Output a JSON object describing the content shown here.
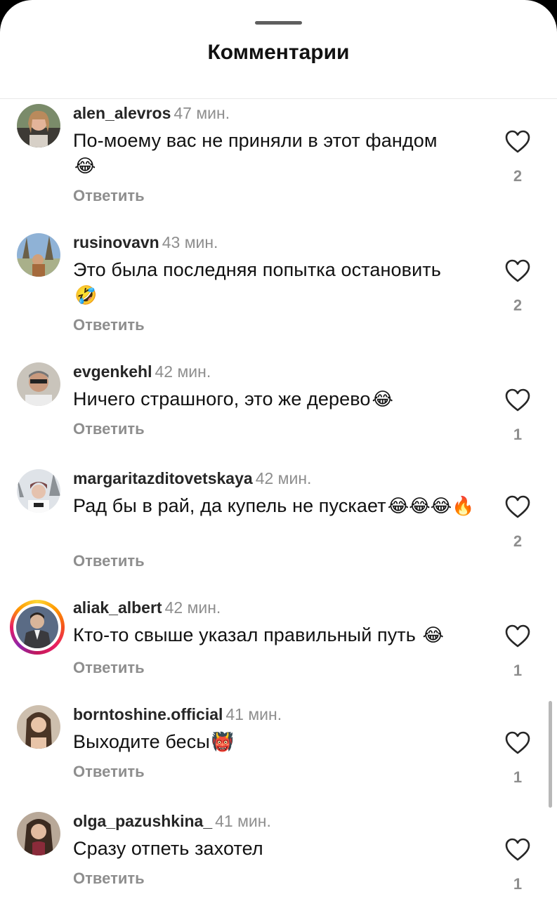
{
  "header": {
    "title": "Комментарии"
  },
  "reply_label": "Ответить",
  "comments": [
    {
      "user": "alen_alevros",
      "time": "47 мин.",
      "text": "По-моему вас не приняли в этот фандом",
      "emoji": "😂",
      "likes": "2"
    },
    {
      "user": "rusinovavn",
      "time": "43 мин.",
      "text": "Это была последняя попытка остановить",
      "emoji": "🤣",
      "likes": "2"
    },
    {
      "user": "evgenkehl",
      "time": "42 мин.",
      "text": "Ничего страшного, это же дерево",
      "emoji": "😂",
      "likes": "1"
    },
    {
      "user": "margaritazditovetskaya",
      "time": "42 мин.",
      "text": "Рад бы в рай, да купель не пускает",
      "emoji": "😂😂😂🔥",
      "likes": "2"
    },
    {
      "user": "aliak_albert",
      "time": "42 мин.",
      "text": "Кто-то свыше указал правильный путь",
      "emoji": "😂",
      "likes": "1"
    },
    {
      "user": "borntoshine.official",
      "time": "41 мин.",
      "text": "Выходите бесы",
      "emoji": "👹",
      "likes": "1"
    },
    {
      "user": "olga_pazushkina_",
      "time": "41 мин.",
      "text": "Сразу отпеть захотел",
      "emoji": "",
      "likes": "1"
    }
  ],
  "colors": {
    "text": "#111111",
    "muted": "#8e8e8e",
    "story_ring": "#e91e63"
  },
  "icons": [
    "heart-outline-icon",
    "avatar"
  ]
}
